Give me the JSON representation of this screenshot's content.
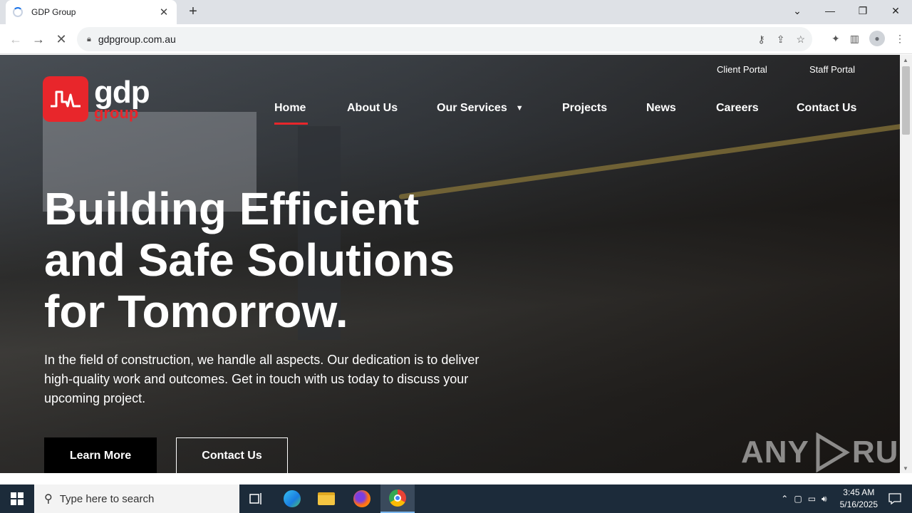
{
  "browser": {
    "tab_title": "GDP Group",
    "url": "gdpgroup.com.au"
  },
  "site": {
    "logo_main": "gdp",
    "logo_sub": "group",
    "top_links": [
      "Client Portal",
      "Staff Portal"
    ],
    "nav": [
      "Home",
      "About Us",
      "Our Services",
      "Projects",
      "News",
      "Careers",
      "Contact Us"
    ],
    "active_nav": "Home",
    "headline_lines": [
      "Building Efficient",
      "and Safe Solutions",
      "for Tomorrow."
    ],
    "lead_lines": [
      "In the field of construction, we handle all aspects. Our dedication is to deliver",
      "high-quality work and outcomes. Get in touch with us today to discuss your",
      "upcoming project."
    ],
    "cta_primary": "Learn More",
    "cta_secondary": "Contact Us",
    "accent_color": "#e8262b"
  },
  "watermark": {
    "left": "ANY",
    "right": "RUN"
  },
  "taskbar": {
    "search_placeholder": "Type here to search",
    "time": "3:45 AM",
    "date": "5/16/2025"
  }
}
